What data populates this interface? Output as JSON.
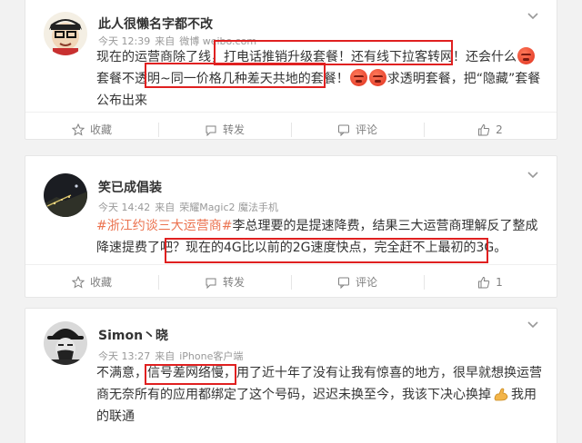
{
  "posts": [
    {
      "author": "此人很懒名字都不改",
      "time": "今天 12:39",
      "source_prefix": "来自",
      "source": "微博 weibo.com",
      "segments": [
        "现在的运营商除了线",
        "打电话推销升级套餐！还有线下拉客转网！",
        "还会什么",
        "套餐不透明~",
        "同一价格几种差天共地的套餐！",
        "求透明套餐，把“隐藏”套餐公布出来"
      ],
      "actions": {
        "favorite": "收藏",
        "repost": "转发",
        "comment": "评论",
        "like_count": "2"
      }
    },
    {
      "author": "笑已成倡装",
      "time": "今天 14:42",
      "source_prefix": "来自",
      "source": "荣耀Magic2 魔法手机",
      "hashtag": "#浙江约谈三大运营商#",
      "segments": [
        "李总理要的是提速降费，结果三大运营商理解反了整成降速提费了吧？",
        "现在的4G比以前的2G速度快点，完全赶不上最初的3G。"
      ],
      "actions": {
        "favorite": "收藏",
        "repost": "转发",
        "comment": "评论",
        "like_count": "1"
      }
    },
    {
      "author": "Simon丶晓",
      "time": "今天 13:27",
      "source_prefix": "来自",
      "source": "iPhone客户端",
      "segments": [
        "不满意，",
        "信号差网络慢，",
        "用了近十年了没有让我有惊喜的地方，很早就想换运营商无奈所有的应用都绑定了这个号码，迟迟未换至今，我该下决心换掉",
        "我用的联通"
      ]
    }
  ],
  "colors": {
    "accent": "#eb7350",
    "highlight": "#e02020",
    "meta": "#999999",
    "page_bg": "#f2f2f2"
  },
  "icons": {
    "chevron": "chevron-down-icon",
    "favorite": "star-icon",
    "repost": "repost-icon",
    "comment": "comment-icon",
    "like": "thumbs-up-icon",
    "emoji": "angry-face-emoji",
    "strong": "flexed-biceps-emoji"
  }
}
